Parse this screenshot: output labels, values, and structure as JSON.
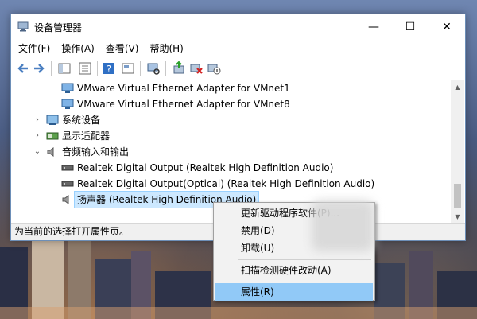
{
  "window": {
    "title": "设备管理器"
  },
  "menu": [
    "文件(F)",
    "操作(A)",
    "查看(V)",
    "帮助(H)"
  ],
  "toolbar_icons": [
    "back-icon",
    "forward-icon",
    "properties-pane-icon",
    "list-icon",
    "help-icon",
    "view-icon",
    "scan-hardware-icon",
    "update-driver-icon",
    "uninstall-icon",
    "disable-icon"
  ],
  "tree": {
    "vmnet1": "VMware Virtual Ethernet Adapter for VMnet1",
    "vmnet8": "VMware Virtual Ethernet Adapter for VMnet8",
    "system_devices": "系统设备",
    "display_adapters": "显示适配器",
    "audio_io": "音频输入和输出",
    "audio_children": [
      "Realtek Digital Output (Realtek High Definition Audio)",
      "Realtek Digital Output(Optical) (Realtek High Definition Audio)",
      "扬声器 (Realtek High Definition Audio)"
    ]
  },
  "status": "为当前的选择打开属性页。",
  "context_menu": {
    "update_driver": "更新驱动程序软件(P)...",
    "disable": "禁用(D)",
    "uninstall": "卸载(U)",
    "scan": "扫描检测硬件改动(A)",
    "properties": "属性(R)"
  },
  "colors": {
    "selection": "#cce8ff",
    "menu_highlight": "#91c9f7",
    "window_border": "#6d8fb8"
  }
}
